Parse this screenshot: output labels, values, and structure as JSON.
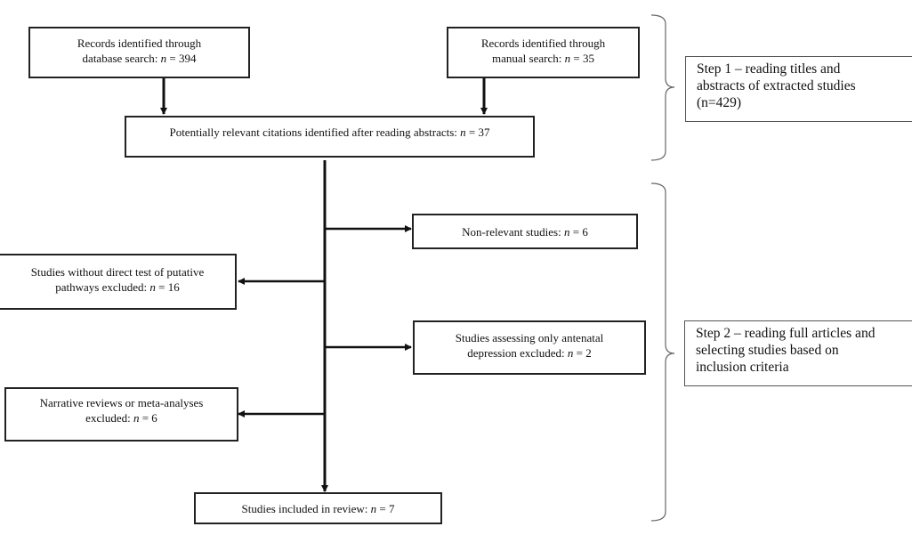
{
  "boxes": {
    "database_search": {
      "line1": "Records identified through",
      "line2_prefix": "database search: ",
      "n_label": "n",
      "line2_suffix": " = 394"
    },
    "manual_search": {
      "line1": "Records identified through",
      "line2_prefix": "manual search: ",
      "n_label": "n",
      "line2_suffix": " = 35"
    },
    "potentially_relevant": {
      "line1_prefix": "Potentially relevant citations identified after reading abstracts: ",
      "n_label": "n",
      "line1_suffix": " = 37"
    },
    "non_relevant": {
      "line1_prefix": "Non-relevant studies: ",
      "n_label": "n",
      "line1_suffix": " = 6"
    },
    "without_direct_test": {
      "line1": "Studies without direct test of putative",
      "line2_prefix": "pathways excluded: ",
      "n_label": "n",
      "line2_suffix": " = 16"
    },
    "antenatal_only": {
      "line1": "Studies assessing only antenatal",
      "line2_prefix": "depression excluded: ",
      "n_label": "n",
      "line2_suffix": " = 2"
    },
    "reviews_meta": {
      "line1": "Narrative reviews or meta-analyses",
      "line2_prefix": "excluded: ",
      "n_label": "n",
      "line2_suffix": " = 6"
    },
    "included": {
      "line1_prefix": "Studies included in review: ",
      "n_label": "n",
      "line1_suffix": " = 7"
    }
  },
  "steps": {
    "step1": {
      "line1": "Step 1 – reading titles and",
      "line2": "abstracts of extracted studies",
      "line3": "(n=429)"
    },
    "step2": {
      "line1": "Step 2 – reading full articles and",
      "line2": "selecting studies based on",
      "line3": "inclusion criteria"
    }
  }
}
